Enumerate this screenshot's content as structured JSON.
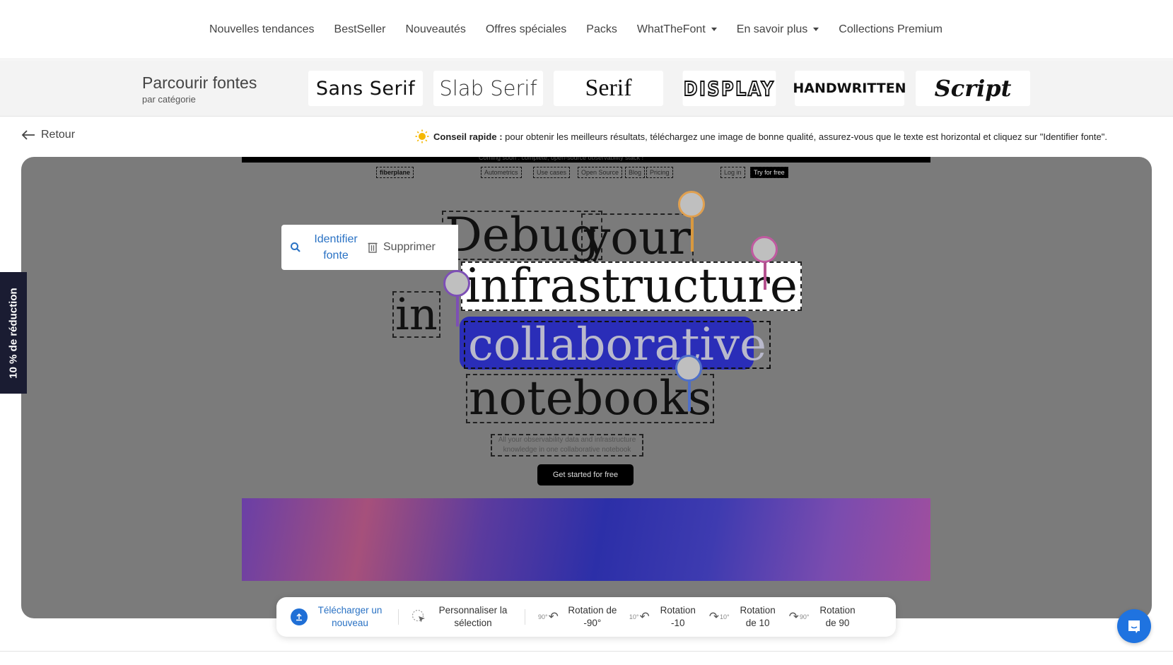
{
  "nav": {
    "items": [
      {
        "label": "Nouvelles tendances",
        "dropdown": false
      },
      {
        "label": "BestSeller",
        "dropdown": false
      },
      {
        "label": "Nouveautés",
        "dropdown": false
      },
      {
        "label": "Offres spéciales",
        "dropdown": false
      },
      {
        "label": "Packs",
        "dropdown": false
      },
      {
        "label": "WhatTheFont",
        "dropdown": true
      },
      {
        "label": "En savoir plus",
        "dropdown": true
      },
      {
        "label": "Collections Premium",
        "dropdown": false
      }
    ]
  },
  "categories": {
    "title": "Parcourir fontes",
    "subtitle": "par catégorie",
    "items": [
      "Sans Serif",
      "Slab Serif",
      "Serif",
      "DISPLAY",
      "HANDWRITTEN",
      "Script"
    ]
  },
  "back_label": "Retour",
  "tip": {
    "label": "Conseil rapide :",
    "text": "pour obtenir les meilleurs résultats, téléchargez une image de bonne qualité, assurez-vous que le texte est horizontal et cliquez sur \"Identifier fonte\"."
  },
  "uploaded_image": {
    "banner_text": "Coming soon : complete, open-source observability stack !",
    "logo": "fiberplane",
    "menu": [
      "Autometrics",
      "Use cases",
      "Open Source",
      "Blog",
      "Pricing"
    ],
    "login": "Log in",
    "try_label": "Try for free",
    "headline_words": [
      "Debug",
      "your",
      "infrastructure",
      "in",
      "collaborative",
      "notebooks"
    ],
    "subtext": "All your observability data and infrastructure knowledge in one collaborative notebook",
    "cta": "Get started for free"
  },
  "context_menu": {
    "identify_label": "Identifier fonte",
    "delete_label": "Supprimer"
  },
  "discount_tab": "10 % de réduction",
  "toolbar": {
    "upload_label": "Télécharger un nouveau",
    "customize_label": "Personnaliser la sélection",
    "rotations": [
      {
        "label": "Rotation de -90°",
        "badge": "90°",
        "dir": "ccw"
      },
      {
        "label": "Rotation -10",
        "badge": "10°",
        "dir": "ccw"
      },
      {
        "label": "Rotation de 10",
        "badge": "10°",
        "dir": "cw"
      },
      {
        "label": "Rotation de 90",
        "badge": "90°",
        "dir": "cw"
      }
    ]
  },
  "colors": {
    "accent_blue": "#1f6fd6",
    "link_blue": "#2a72c4",
    "highlight_blue": "#2a2db8",
    "discount_bg": "#1a1c32"
  }
}
